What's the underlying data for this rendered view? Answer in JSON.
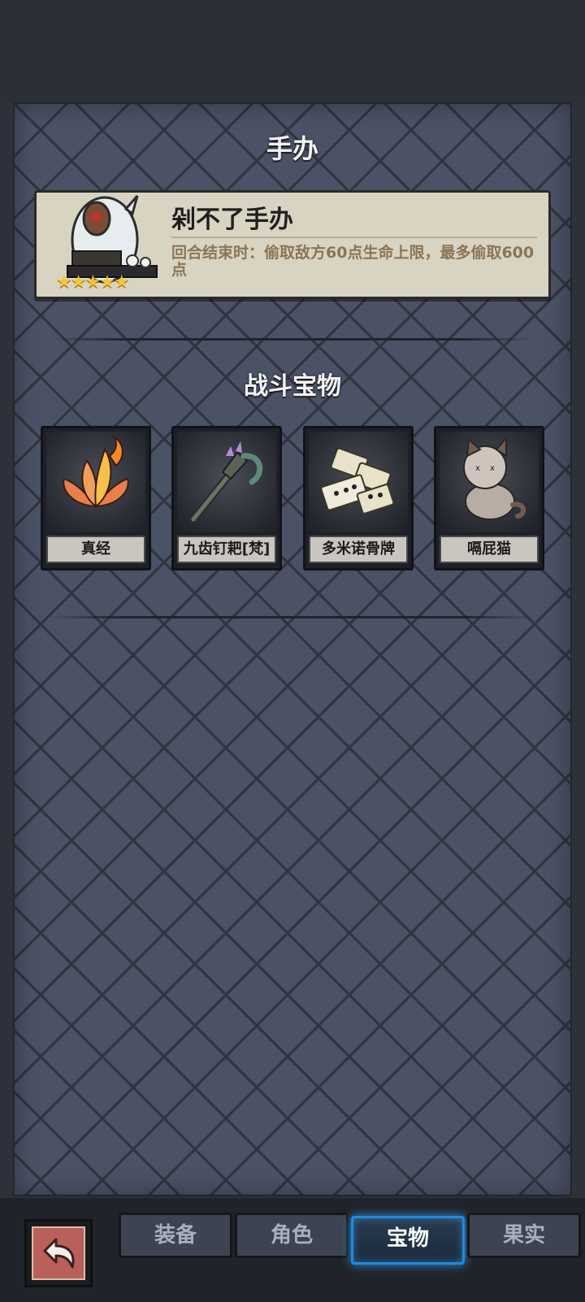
{
  "header": {
    "title": "手办"
  },
  "figurine": {
    "name": "剁不了手办",
    "description": "回合结束时：偷取敌方60点生命上限，最多偷取600点",
    "stars": 5
  },
  "section": {
    "title": "战斗宝物"
  },
  "treasures": [
    {
      "name": "真经",
      "icon": "flame-lotus-icon"
    },
    {
      "name": "九齿钉耙[梵]",
      "icon": "rake-icon"
    },
    {
      "name": "多米诺骨牌",
      "icon": "dominoes-icon"
    },
    {
      "name": "嗝屁猫",
      "icon": "cat-icon"
    }
  ],
  "tabs": [
    {
      "label": "装备",
      "active": false
    },
    {
      "label": "角色",
      "active": false
    },
    {
      "label": "宝物",
      "active": true
    },
    {
      "label": "果实",
      "active": false
    }
  ],
  "colors": {
    "active_tab_glow": "#1e8ce0",
    "description_text": "#8b7555"
  }
}
